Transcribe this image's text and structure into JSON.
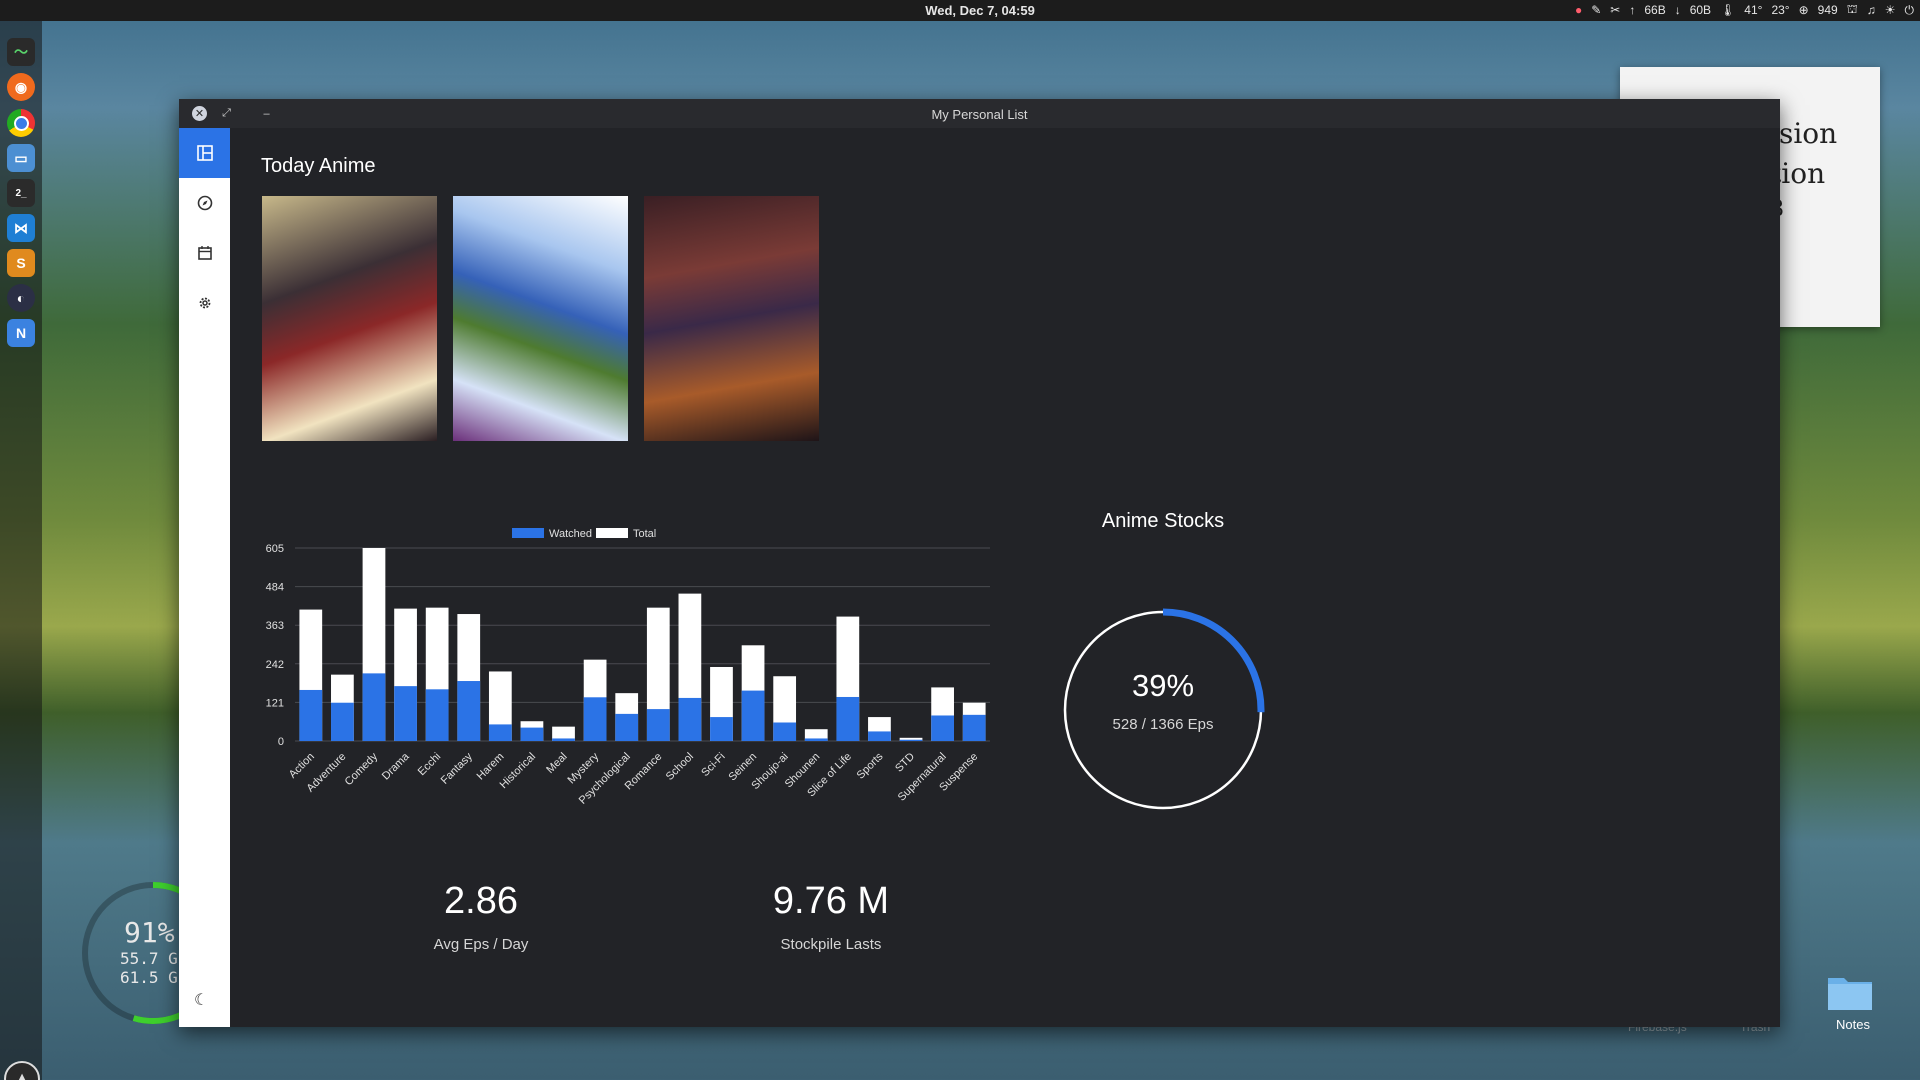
{
  "topbar": {
    "clock": "Wed, Dec  7, 04:59",
    "tray": [
      "66B",
      "60B",
      "41°",
      "23°",
      "949"
    ]
  },
  "desktop": {
    "note_lines": [
      "lsion",
      "tion",
      "8"
    ],
    "gauge": {
      "percent": "91%",
      "line1": "55.7 G",
      "line2": "61.5 G",
      "level": 0.91
    },
    "notes_label": "Notes",
    "ghost_labels": [
      "Firebase.js",
      "Trash"
    ]
  },
  "window": {
    "title": "My Personal List"
  },
  "sidebar": {
    "items": [
      {
        "name": "dashboard-icon",
        "active": true
      },
      {
        "name": "compass-icon",
        "active": false
      },
      {
        "name": "calendar-icon",
        "active": false
      },
      {
        "name": "gear-icon",
        "active": false
      }
    ]
  },
  "main": {
    "today_title": "Today Anime",
    "stocks_title": "Anime Stocks",
    "stocks": {
      "percent_label": "39%",
      "eps_label": "528 / 1366 Eps",
      "fraction": 0.39
    },
    "stats": [
      {
        "value": "2.86",
        "label": "Avg Eps / Day"
      },
      {
        "value": "9.76 M",
        "label": "Stockpile Lasts"
      }
    ]
  },
  "colors": {
    "accent": "#2b73e6",
    "bg": "#222327",
    "bar_total": "#ffffff"
  },
  "chart_data": {
    "type": "bar",
    "categories": [
      "Action",
      "Adventure",
      "Comedy",
      "Drama",
      "Ecchi",
      "Fantasy",
      "Harem",
      "Historical",
      "Meal",
      "Mystery",
      "Psychological",
      "Romance",
      "School",
      "Sci-Fi",
      "Seinen",
      "Shoujo-ai",
      "Shounen",
      "Slice of Life",
      "Sports",
      "STD",
      "Supernatural",
      "Suspense"
    ],
    "series": [
      {
        "name": "Watched",
        "values": [
          160,
          120,
          212,
          172,
          162,
          188,
          52,
          42,
          8,
          137,
          85,
          100,
          135,
          75,
          158,
          58,
          8,
          138,
          30,
          4,
          80,
          82
        ]
      },
      {
        "name": "Total",
        "values": [
          412,
          208,
          605,
          415,
          418,
          398,
          218,
          62,
          45,
          255,
          150,
          418,
          462,
          232,
          300,
          203,
          37,
          390,
          75,
          10,
          168,
          120
        ]
      }
    ],
    "yticks": [
      0,
      121,
      242,
      363,
      484,
      605
    ],
    "ylim": [
      0,
      605
    ],
    "legend_position": "top-center",
    "grid": true
  }
}
